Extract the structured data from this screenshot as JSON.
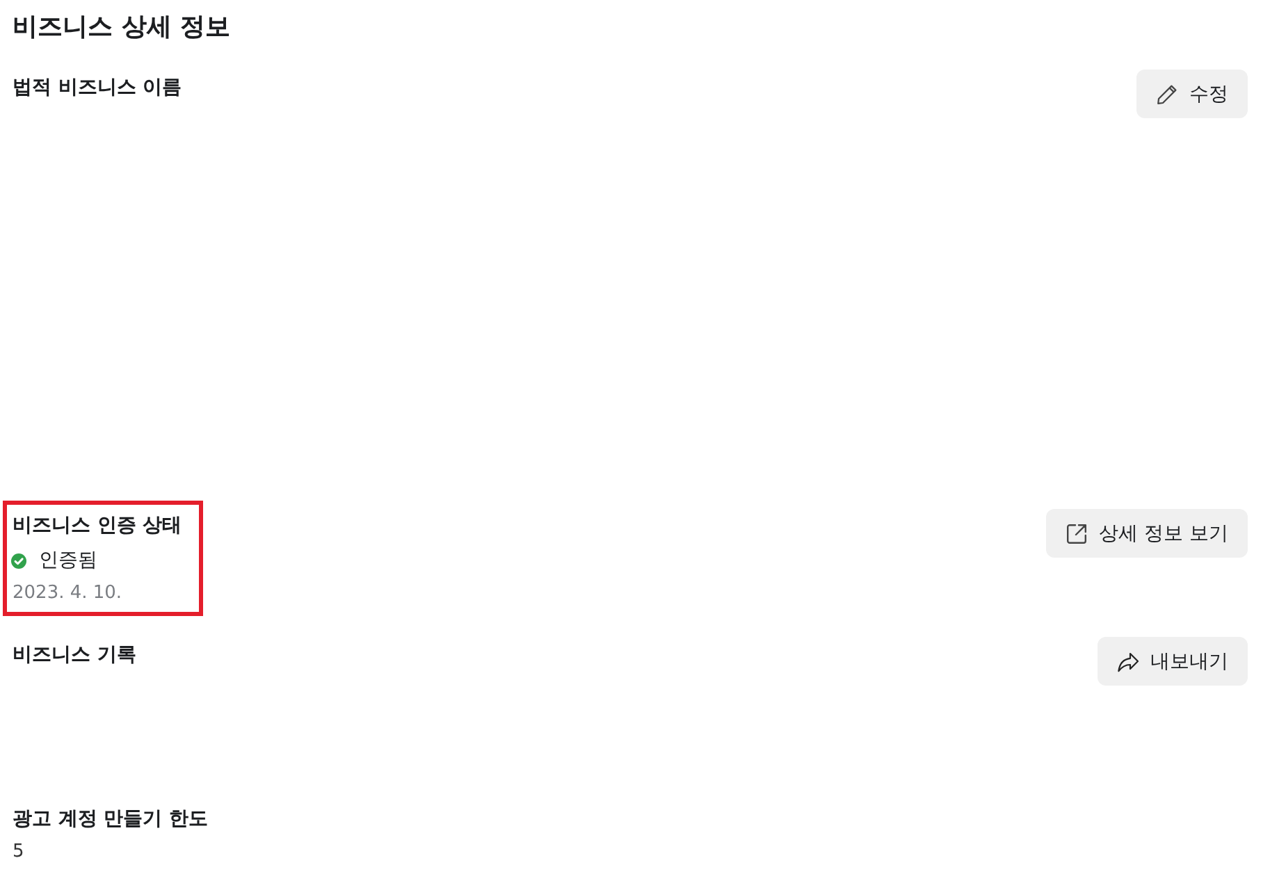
{
  "title": "비즈니스 상세 정보",
  "sections": [
    {
      "label": "법적 비즈니스 이름",
      "highlighted": false,
      "button": {
        "kind": "edit",
        "label": "수정"
      }
    },
    {
      "label": "비즈니스 인증 상태",
      "highlighted": true,
      "status": {
        "text": "인증됨",
        "verified": true
      },
      "date": "2023. 4. 10.",
      "button": {
        "kind": "view",
        "label": "상세 정보 보기"
      }
    },
    {
      "label": "비즈니스 기록",
      "highlighted": false,
      "button": {
        "kind": "export",
        "label": "내보내기"
      }
    },
    {
      "label": "광고 계정 만들기 한도",
      "highlighted": false,
      "value": "5"
    }
  ]
}
